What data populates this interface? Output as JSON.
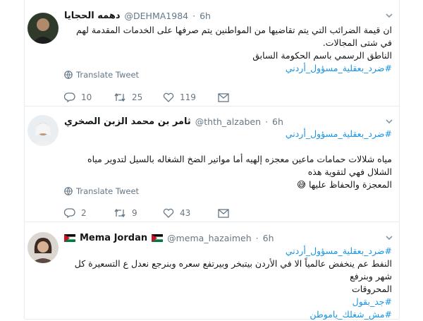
{
  "tweets": [
    {
      "name": "دهمه الحجايا",
      "handle": "@DEHMA1984",
      "time": "6h",
      "lines": [
        "ان قيمة الضرائب التي يتم تقاضيها من المواطنين يتم صرفها على الخدمات المقدمة لهم في شتى المجالات.",
        "الناطق الرسمي باسم الحكومة السابق",
        "#ضرد_بعقلية_مسؤول_أردني"
      ],
      "translate": "Translate Tweet",
      "replies": "10",
      "retweets": "25",
      "likes": "119"
    },
    {
      "name": "ثامر بن محمد الزبن الصخري",
      "handle": "@thth_alzaben",
      "time": "6h",
      "lines": [
        "#ضرد_بعقلية_مسؤول_أردني",
        "مياه شلالات حمامات ماعين معجزه إلهيه أما مواتير الضخ الشغاله بالسيل لتدوير مياه الشلال فهي لتقوية هذه",
        "المعجزة والحفاظ عليها 😅"
      ],
      "translate": "Translate Tweet",
      "replies": "2",
      "retweets": "9",
      "likes": "43"
    },
    {
      "name": "Mema Jordan",
      "handle": "@mema_hazaimeh",
      "time": "6h",
      "lines": [
        "#ضرد_بعقلية_مسؤول_أردني",
        "النفط عم ينخفض عالمياً الا في الأردن بيتبخر وبيرتفع سعره وبنرجع نعدل ع التسعيرة كل شهر وبنرفع",
        "المحروقات",
        "#جد_بقول",
        "#مش_شغلك_ياموطن"
      ]
    }
  ],
  "colors": {
    "hashtag": "#1b95e0",
    "muted": "#657786",
    "divider": "#e6ecf0"
  },
  "icons": [
    "chevron-down-icon",
    "globe-icon",
    "reply-icon",
    "retweet-icon",
    "like-icon",
    "message-icon",
    "jordan-flag-icon"
  ]
}
